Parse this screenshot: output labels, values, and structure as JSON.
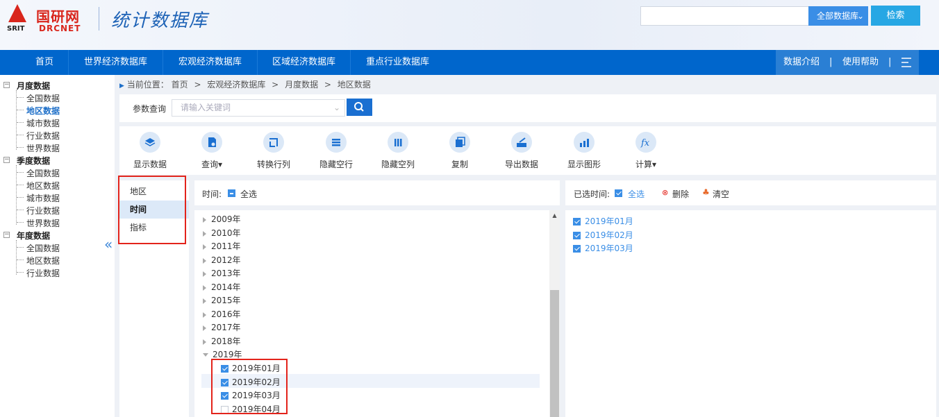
{
  "header": {
    "logo_cn": "国研网",
    "logo_srit": "SRIT",
    "logo_en": "DRCNET",
    "site_title": "统计数据库",
    "search": {
      "value": "",
      "placeholder": ""
    },
    "search_scope": "全部数据库",
    "search_button": "检索"
  },
  "nav": {
    "items": [
      "首页",
      "世界经济数据库",
      "宏观经济数据库",
      "区域经济数据库",
      "重点行业数据库"
    ],
    "right_items": [
      "数据介绍",
      "|",
      "使用帮助",
      "|"
    ],
    "menu_icon": "menu-lines-icon"
  },
  "sidebar": {
    "groups": [
      {
        "label": "月度数据",
        "items": [
          "全国数据",
          "地区数据",
          "城市数据",
          "行业数据",
          "世界数据"
        ]
      },
      {
        "label": "季度数据",
        "items": [
          "全国数据",
          "地区数据",
          "城市数据",
          "行业数据",
          "世界数据"
        ]
      },
      {
        "label": "年度数据",
        "items": [
          "全国数据",
          "地区数据",
          "行业数据"
        ]
      }
    ],
    "active": "月度数据/地区数据",
    "collapse_glyph": "«"
  },
  "breadcrumb": {
    "prefix": "当前位置：",
    "parts": [
      "首页",
      "宏观经济数据库",
      "月度数据",
      "地区数据"
    ],
    "sep": ">"
  },
  "param_query": {
    "label": "参数查询",
    "placeholder": "请输入关键词",
    "value": ""
  },
  "toolbar": {
    "items": [
      {
        "label": "显示数据",
        "icon": "layers-icon"
      },
      {
        "label": "查询▾",
        "icon": "file-search-icon"
      },
      {
        "label": "转换行列",
        "icon": "transpose-icon"
      },
      {
        "label": "隐藏空行",
        "icon": "list-icon"
      },
      {
        "label": "隐藏空列",
        "icon": "columns-icon"
      },
      {
        "label": "复制",
        "icon": "copy-icon"
      },
      {
        "label": "导出数据",
        "icon": "export-icon"
      },
      {
        "label": "显示图形",
        "icon": "chart-icon"
      },
      {
        "label": "计算▾",
        "icon": "fx-icon"
      }
    ]
  },
  "dimensions": {
    "items": [
      "地区",
      "时间",
      "指标"
    ],
    "active": "时间"
  },
  "time_panel": {
    "label": "时间:",
    "select_all": "全选",
    "years": [
      "2009年",
      "2010年",
      "2011年",
      "2012年",
      "2013年",
      "2014年",
      "2015年",
      "2016年",
      "2017年",
      "2018年",
      "2019年"
    ],
    "months": [
      {
        "label": "2019年01月",
        "checked": true
      },
      {
        "label": "2019年02月",
        "checked": true
      },
      {
        "label": "2019年03月",
        "checked": true
      },
      {
        "label": "2019年04月",
        "checked": false
      }
    ]
  },
  "selected_panel": {
    "label": "已选时间:",
    "select_all": "全选",
    "delete": "删除",
    "clear": "清空",
    "items": [
      "2019年01月",
      "2019年02月",
      "2019年03月"
    ]
  },
  "colors": {
    "nav": "#0066cc",
    "accent": "#3a8ee6",
    "highlight": "#e3231b"
  }
}
